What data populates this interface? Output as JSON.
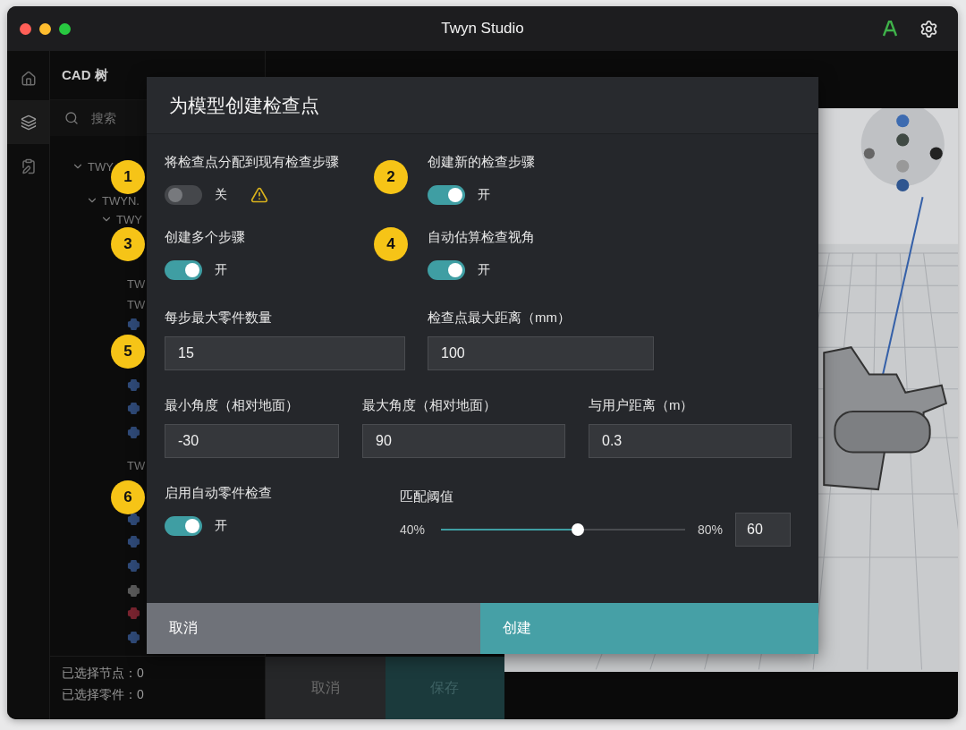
{
  "window": {
    "title": "Twyn Studio"
  },
  "rail": [
    {
      "kind": "home",
      "selected": false
    },
    {
      "kind": "layers",
      "selected": true
    },
    {
      "kind": "document",
      "selected": false
    }
  ],
  "tree_panel": {
    "title": "CAD 树",
    "search": {
      "placeholder": "搜索"
    },
    "nodes": [
      {
        "label": "TWY",
        "expanded": true,
        "children": [
          {
            "label": "TWYN.",
            "expanded": true,
            "children": [
              {
                "label": "TWY",
                "expanded": true,
                "children": [
                  {
                    "label": "TW"
                  },
                  {
                    "label": "TW"
                  },
                  {
                    "color": "#2f4a78"
                  },
                  {
                    "color": "#2f4a78"
                  },
                  {
                    "color": "#2f4a78"
                  },
                  {
                    "color": "#2f4a78"
                  },
                  {
                    "label": "TW"
                  },
                  {
                    "color": "#2f4a78"
                  },
                  {
                    "color": "#2f4a78"
                  },
                  {
                    "color": "#2f4a78"
                  },
                  {
                    "color": "#5a5a5a"
                  },
                  {
                    "color": "#7a2430"
                  },
                  {
                    "color": "#2f4a78"
                  }
                ]
              }
            ]
          }
        ]
      }
    ],
    "status": [
      "已选择节点：0",
      "已选择零件：0"
    ]
  },
  "side_buttons": [
    {
      "label": "取消",
      "kind": "cancel"
    },
    {
      "label": "保存",
      "kind": "save"
    }
  ],
  "dialog": {
    "title": "为模型创建检查点",
    "rows": [
      {
        "kind": "toggles",
        "fields": [
          {
            "badge": "1",
            "label": "将检查点分配到现有检查步骤",
            "on": false,
            "state_text": "关",
            "warning": true
          },
          {
            "badge": "2",
            "label": "创建新的检查步骤",
            "on": true,
            "state_text": "开",
            "warning": false
          }
        ]
      },
      {
        "kind": "toggles",
        "fields": [
          {
            "badge": "3",
            "label": "创建多个步骤",
            "on": true,
            "state_text": "开",
            "warning": false
          },
          {
            "badge": "4",
            "label": "自动估算检查视角",
            "on": true,
            "state_text": "开",
            "warning": false
          }
        ]
      },
      {
        "kind": "inputs2",
        "fields": [
          {
            "badge": "5",
            "label": "每步最大零件数量",
            "value": "15"
          },
          {
            "label": "检查点最大距离（mm）",
            "value": "100"
          }
        ]
      },
      {
        "kind": "inputs3",
        "fields": [
          {
            "label": "最小角度（相对地面）",
            "value": "-30"
          },
          {
            "label": "最大角度（相对地面）",
            "value": "90"
          },
          {
            "label": "与用户距离（m）",
            "value": "0.3"
          }
        ]
      },
      {
        "kind": "threshold",
        "enable": {
          "badge": "6",
          "label": "启用自动零件检查",
          "on": true,
          "state_text": "开",
          "warning": false
        },
        "slider": {
          "label": "匹配阈值",
          "min_label": "40%",
          "max_label": "80%",
          "level": 0.56,
          "value": "60"
        }
      }
    ],
    "buttons": [
      {
        "label": "取消",
        "kind": "cancel"
      },
      {
        "label": "创建",
        "kind": "primary"
      }
    ]
  }
}
